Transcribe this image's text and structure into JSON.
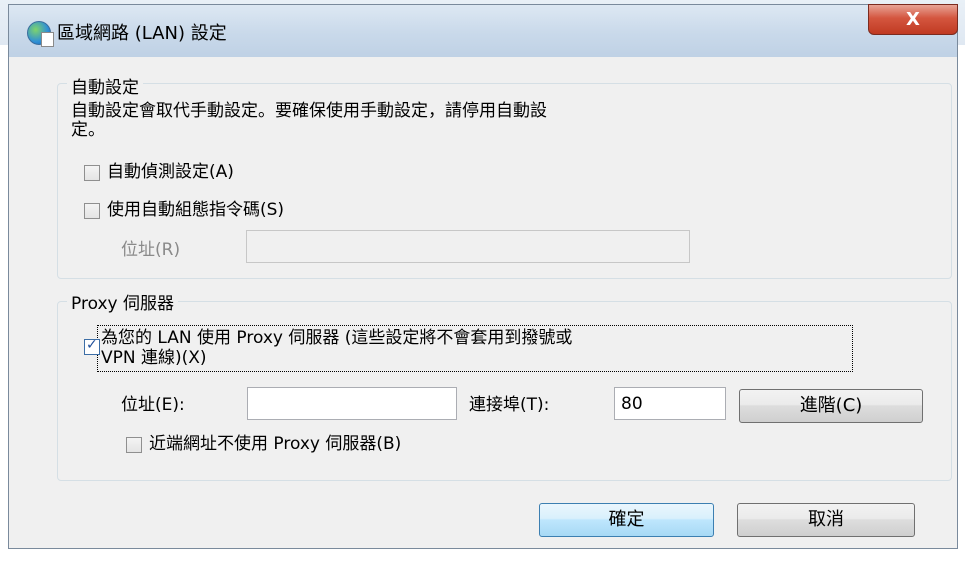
{
  "window": {
    "title": "區域網路 (LAN) 設定",
    "close_glyph": "X"
  },
  "auto_config": {
    "legend": "自動設定",
    "description_line1": "自動設定會取代手動設定。要確保使用手動設定，請停用自動設",
    "description_line2": "定。",
    "auto_detect": {
      "label": "自動偵測設定(A)",
      "checked": false
    },
    "use_script": {
      "label": "使用自動組態指令碼(S)",
      "checked": false
    },
    "address": {
      "label": "位址(R)",
      "value": "",
      "enabled": false
    }
  },
  "proxy": {
    "legend": "Proxy 伺服器",
    "use_proxy": {
      "label_line1": "為您的 LAN 使用 Proxy 伺服器 (這些設定將不會套用到撥號或",
      "label_line2": "VPN 連線)(X)",
      "checked": true
    },
    "address": {
      "label": "位址(E):",
      "value": ""
    },
    "port": {
      "label": "連接埠(T):",
      "value": "80"
    },
    "advanced_button": "進階(C)",
    "bypass_local": {
      "label": "近端網址不使用 Proxy 伺服器(B)",
      "checked": false
    }
  },
  "buttons": {
    "ok": "確定",
    "cancel": "取消"
  },
  "colors": {
    "accent": "#3c7fb1",
    "close": "#c03a22"
  }
}
